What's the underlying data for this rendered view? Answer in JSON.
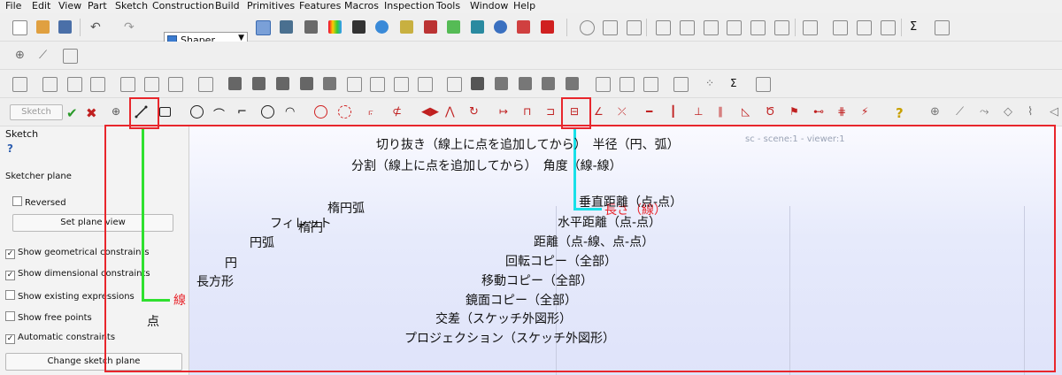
{
  "menubar": [
    "File",
    "Edit",
    "View",
    "Part",
    "Sketch",
    "Construction",
    "Build",
    "Primitives",
    "Features",
    "Macros",
    "Inspection",
    "Tools",
    "Window",
    "Help"
  ],
  "toolbar": {
    "workbench_select": "Shaper"
  },
  "sketch_toolbar": {
    "sketch_button": "Sketch"
  },
  "panel": {
    "title": "Sketch",
    "help_glyph": "?",
    "section": "Sketcher plane",
    "reversed": "Reversed",
    "set_plane_view": "Set plane view",
    "checks": [
      {
        "label": "Show geometrical constraints",
        "checked": true
      },
      {
        "label": "Show dimensional constraints",
        "checked": true
      },
      {
        "label": "Show existing expressions",
        "checked": false
      },
      {
        "label": "Show free points",
        "checked": false
      },
      {
        "label": "Automatic constraints",
        "checked": true
      }
    ],
    "change_sketch_plane": "Change sketch plane"
  },
  "viewer_title": "sc - scene:1 - viewer:1",
  "annotations": {
    "left": [
      "楕円弧",
      "楕円",
      "フィレット",
      "円弧",
      "円",
      "長方形",
      "点"
    ],
    "line_label": "線",
    "right": [
      "切り抜き（線上に点を追加してから）　半径（円、弧）",
      "分割（線上に点を追加してから）　角度（線-線）",
      "垂直距離（点-点）",
      "水平距離（点-点）",
      "距離（点-線、点-点）",
      "回転コピー（全部）",
      "移動コピー（全部）",
      "鏡面コピー（全部）",
      "交差（スケッチ外図形）",
      "プロジェクション（スケッチ外図形）"
    ],
    "length_label": "長さ（線）"
  },
  "colors": {
    "annotation_red": "#e8262c",
    "green_marker": "#2fe02f",
    "cyan_marker": "#19e0e8"
  }
}
